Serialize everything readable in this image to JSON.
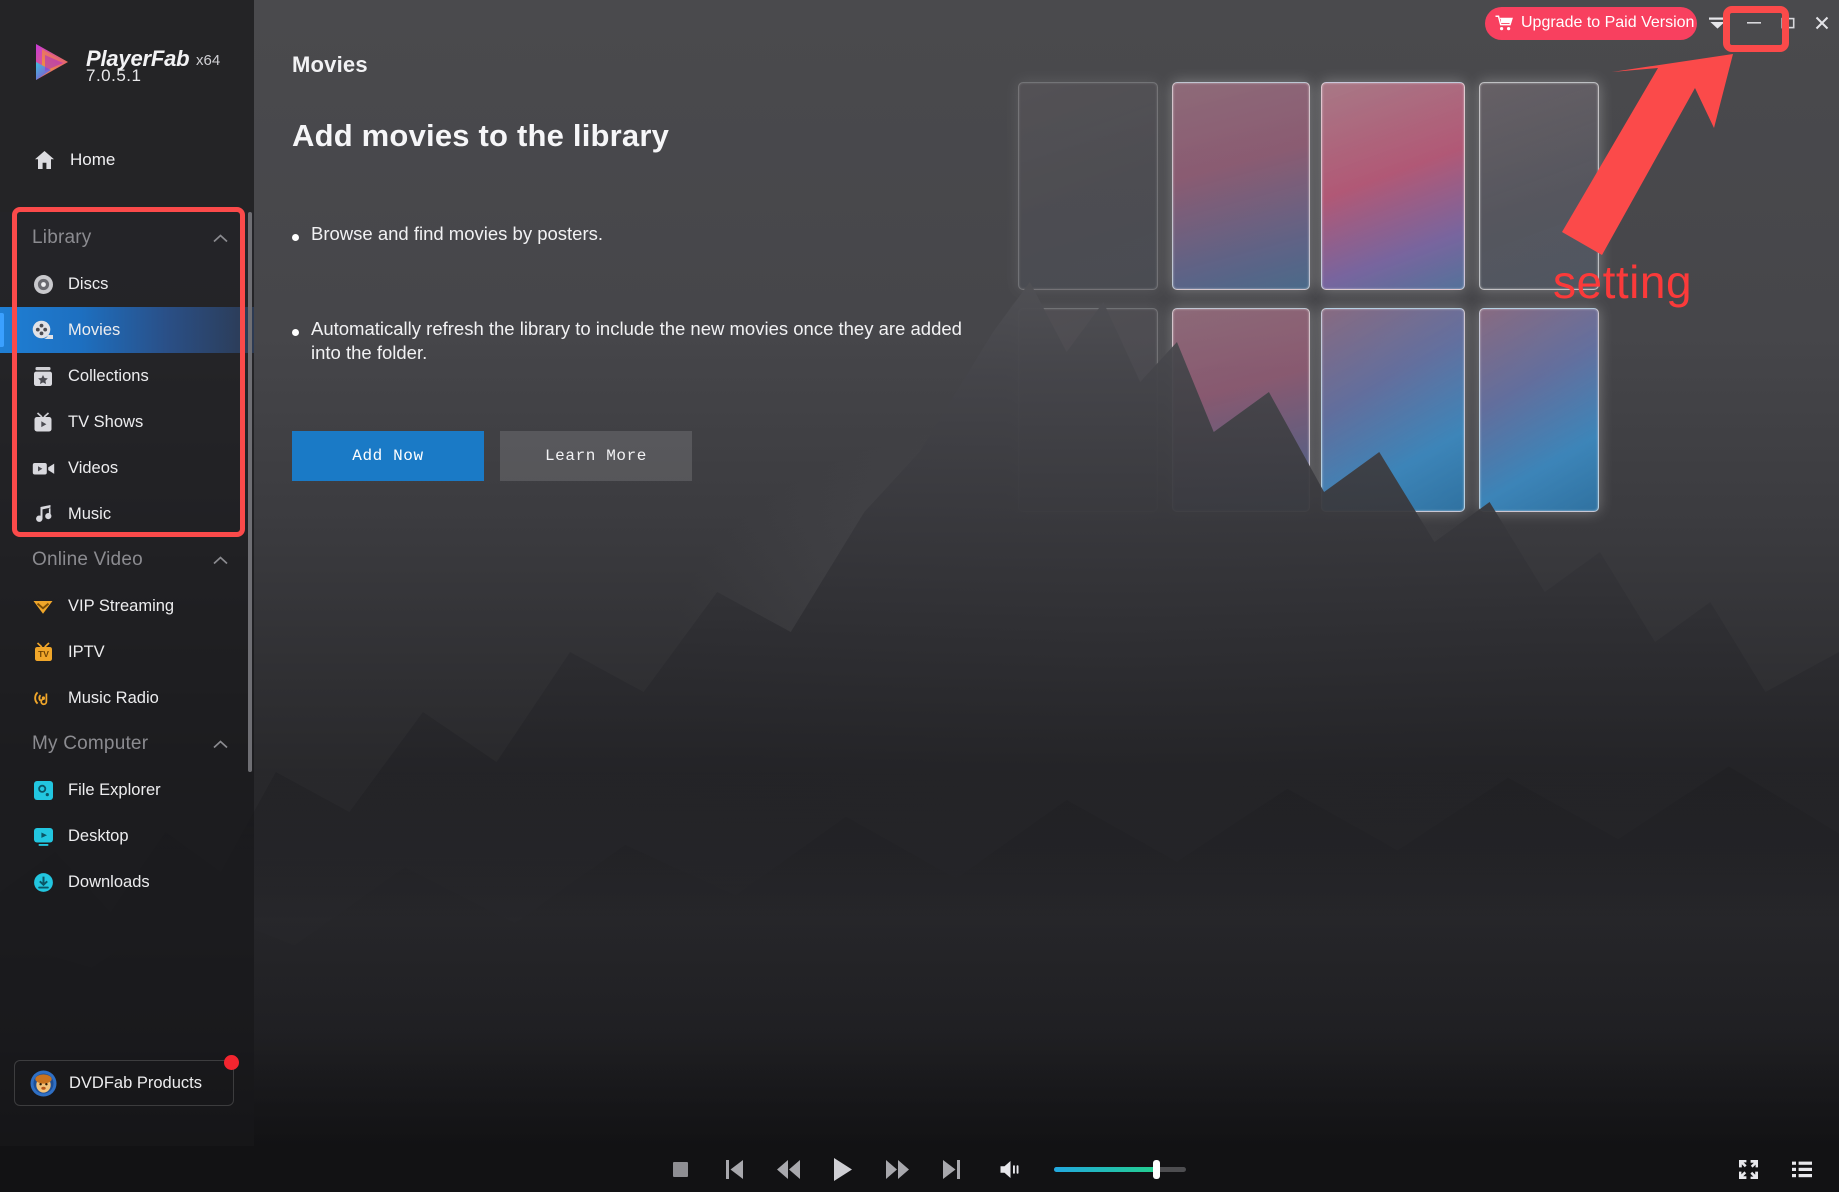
{
  "app": {
    "brand_name": "PlayerFab",
    "architecture": "x64",
    "version": "7.0.5.1",
    "logo_icon": "playerfab-play-logo"
  },
  "titlebar": {
    "upgrade_label": "Upgrade to Paid Version",
    "cart_icon": "shopping-cart-icon",
    "dropdown_icon": "chevron-down-icon",
    "minimize_icon": "minimize-icon",
    "maximize_icon": "maximize-icon",
    "close_icon": "close-icon"
  },
  "sidebar": {
    "home": {
      "label": "Home",
      "icon": "home-icon"
    },
    "groups": [
      {
        "label": "Library",
        "collapse_icon": "chevron-up-icon",
        "items": [
          {
            "label": "Discs",
            "icon": "disc-icon",
            "active": false
          },
          {
            "label": "Movies",
            "icon": "film-reel-icon",
            "active": true
          },
          {
            "label": "Collections",
            "icon": "collections-icon",
            "active": false
          },
          {
            "label": "TV Shows",
            "icon": "tv-icon",
            "active": false
          },
          {
            "label": "Videos",
            "icon": "video-camera-icon",
            "active": false
          },
          {
            "label": "Music",
            "icon": "music-note-icon",
            "active": false
          }
        ]
      },
      {
        "label": "Online Video",
        "collapse_icon": "chevron-up-icon",
        "items": [
          {
            "label": "VIP Streaming",
            "icon": "vip-diamond-icon",
            "active": false
          },
          {
            "label": "IPTV",
            "icon": "iptv-icon",
            "active": false
          },
          {
            "label": "Music Radio",
            "icon": "music-radio-icon",
            "active": false
          }
        ]
      },
      {
        "label": "My Computer",
        "collapse_icon": "chevron-up-icon",
        "items": [
          {
            "label": "File Explorer",
            "icon": "file-explorer-icon",
            "active": false
          },
          {
            "label": "Desktop",
            "icon": "desktop-icon",
            "active": false
          },
          {
            "label": "Downloads",
            "icon": "downloads-icon",
            "active": false
          }
        ]
      }
    ],
    "products_button": {
      "label": "DVDFab Products",
      "icon": "dvdfab-mascot-icon",
      "badge": true
    }
  },
  "main": {
    "tab_label": "Movies",
    "title": "Add movies to the library",
    "bullets": [
      "Browse and find movies by posters.",
      "Automatically refresh the library to include the new movies once they are added into the folder."
    ],
    "primary_button": "Add Now",
    "secondary_button": "Learn More"
  },
  "annotations": {
    "setting_label": "setting",
    "color": "#fb4a4a",
    "arrow_icon": "arrow-pointer-icon"
  },
  "player": {
    "stop_icon": "stop-icon",
    "previous_icon": "previous-track-icon",
    "rewind_icon": "rewind-icon",
    "play_icon": "play-icon",
    "forward_icon": "fast-forward-icon",
    "next_icon": "next-track-icon",
    "volume_icon": "volume-icon",
    "volume_percent": 78,
    "fullscreen_icon": "fullscreen-icon",
    "playlist_icon": "playlist-icon"
  },
  "colors": {
    "accent_blue": "#1a7ac6",
    "upgrade_pink": "#f8405f",
    "annotation_red": "#fb4a4a",
    "active_item_blue": "#1f7fd4",
    "volume_from": "#22a8e0",
    "volume_to": "#23cf8f"
  }
}
